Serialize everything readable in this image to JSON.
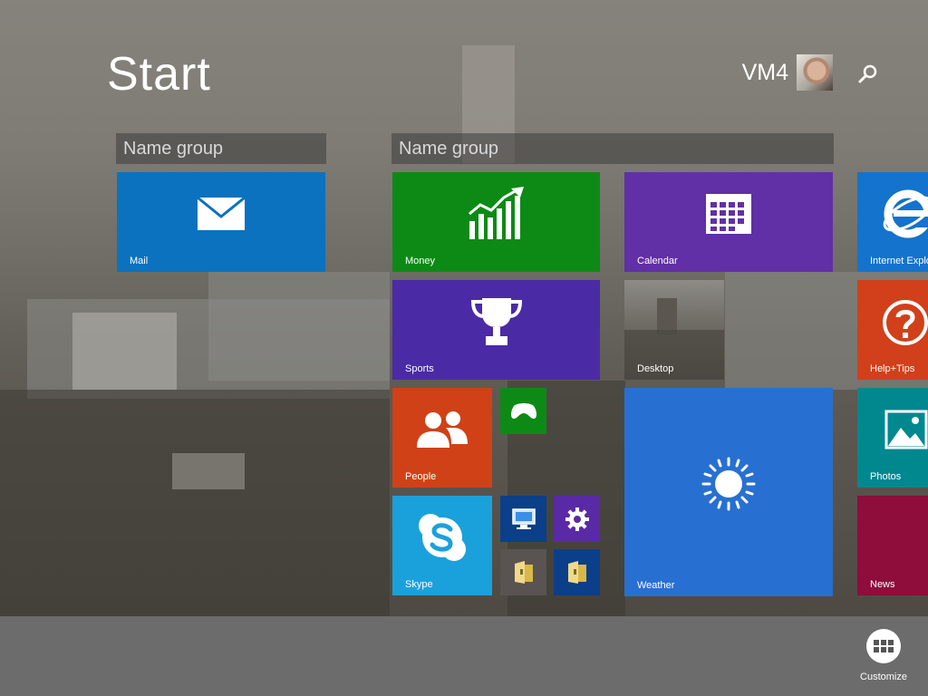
{
  "header": {
    "title": "Start",
    "user_name": "VM4"
  },
  "groups": [
    {
      "name": "Name group"
    },
    {
      "name": "Name group"
    }
  ],
  "tiles": {
    "mail": {
      "label": "Mail",
      "color": "#0a72bf"
    },
    "money": {
      "label": "Money",
      "color": "#0d8a16"
    },
    "calendar": {
      "label": "Calendar",
      "color": "#612fa6"
    },
    "internet_explorer": {
      "label": "Internet Explo",
      "color": "#1473cc"
    },
    "sports": {
      "label": "Sports",
      "color": "#4b2aa6"
    },
    "desktop": {
      "label": "Desktop"
    },
    "help_tips": {
      "label": "Help+Tips",
      "color": "#d1401a"
    },
    "people": {
      "label": "People",
      "color": "#d04118"
    },
    "games": {
      "color": "#0d8a16"
    },
    "weather": {
      "label": "Weather",
      "color": "#2770d2"
    },
    "photos": {
      "label": "Photos",
      "color": "#00888f"
    },
    "skype": {
      "label": "Skype",
      "color": "#1aa1dc"
    },
    "news": {
      "label": "News",
      "color": "#8e0d3a"
    },
    "this_pc": {
      "color": "#0b3f8a"
    },
    "pc_settings": {
      "color": "#5a2aa6"
    },
    "file_explorer_1": {
      "color": "#595451"
    },
    "file_explorer_2": {
      "color": "#0b3f8a"
    }
  },
  "footer": {
    "customize_label": "Customize"
  }
}
